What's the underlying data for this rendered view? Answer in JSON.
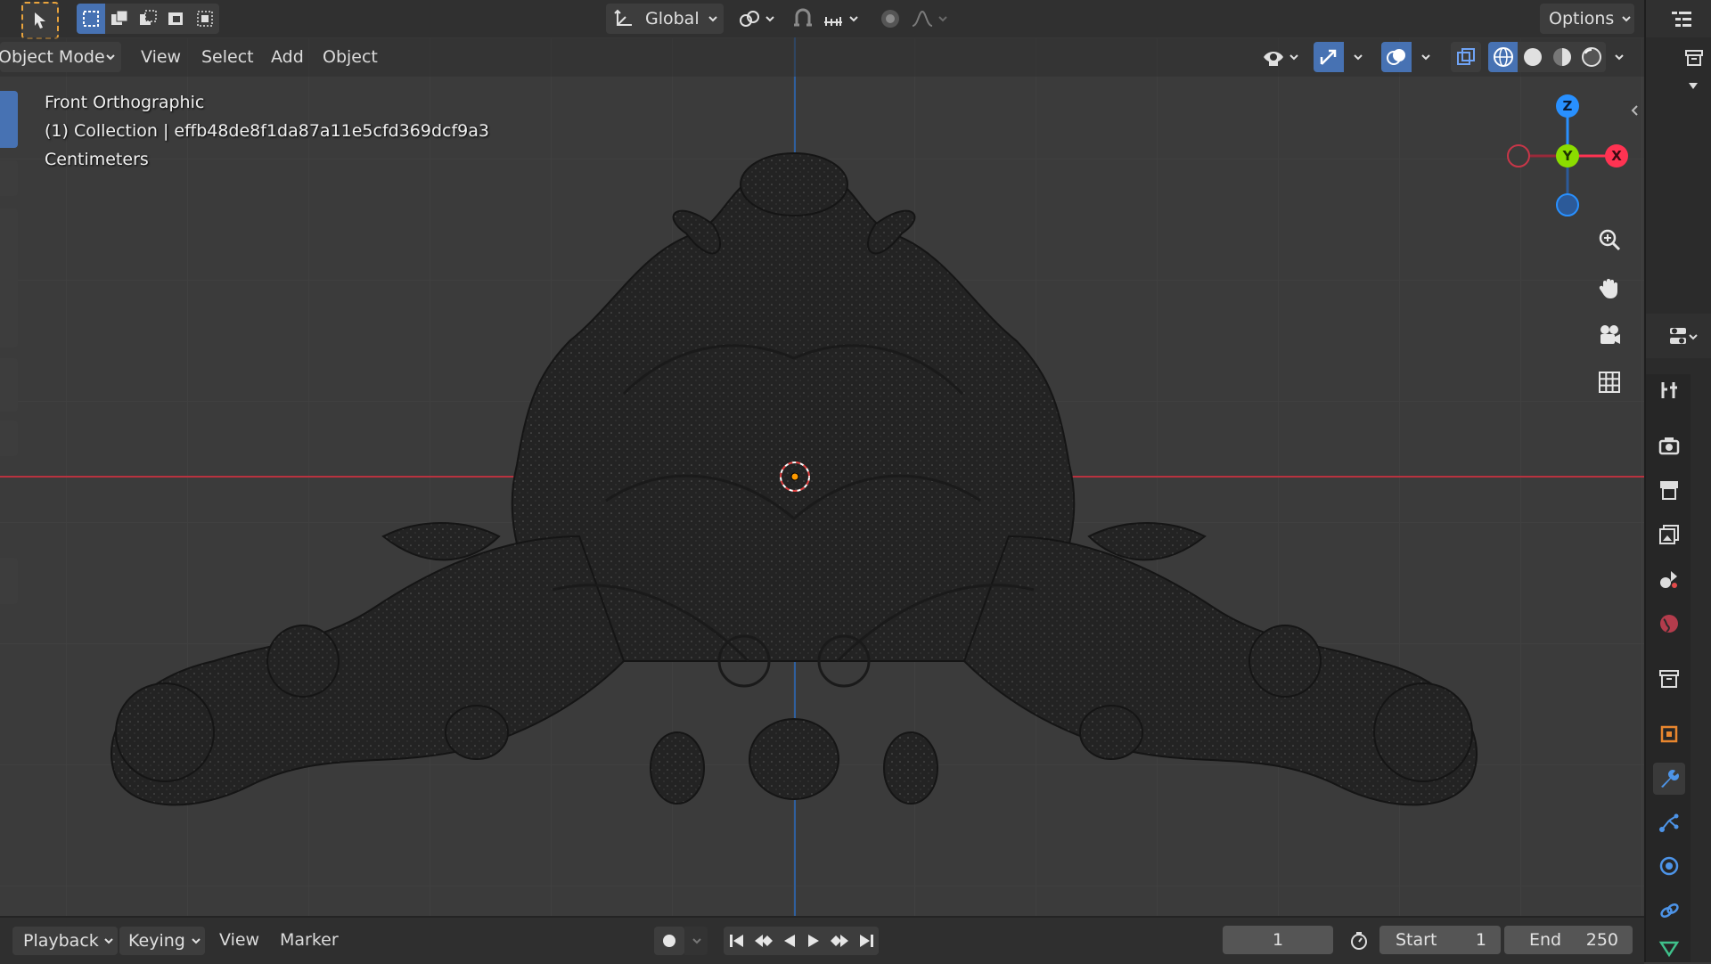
{
  "app": "Blender",
  "tool_header": {
    "transform_orientation": "Global",
    "options_label": "Options"
  },
  "view_header": {
    "mode": "Object Mode",
    "menus": [
      "View",
      "Select",
      "Add",
      "Object"
    ]
  },
  "viewport": {
    "view_name": "Front Orthographic",
    "collection_info": "(1) Collection | effb48de8f1da87a11e5cfd369dcf9a3",
    "units": "Centimeters"
  },
  "gizmo": {
    "z_label": "Z",
    "y_label": "Y",
    "x_label": "X"
  },
  "timeline": {
    "menus": [
      "Playback",
      "Keying",
      "View",
      "Marker"
    ],
    "current_frame": "1",
    "start_label": "Start",
    "start_value": "1",
    "end_label": "End",
    "end_value": "250"
  },
  "colors": {
    "accent_blue": "#4772b3",
    "x_axis": "#ff3352",
    "y_axis": "#8bdc00",
    "z_axis": "#2890ff",
    "header_bg": "#303030",
    "viewport_bg": "#3b3b3b"
  },
  "icons": {
    "tool_header": [
      "select-cursor-icon",
      "select-box-new-icon",
      "select-box-extend-icon",
      "select-box-subtract-icon",
      "select-box-invert-icon",
      "select-box-intersect-icon",
      "transform-orientation-icon",
      "pivot-point-icon",
      "snap-icon",
      "snap-increment-icon",
      "proportional-edit-icon",
      "falloff-curve-icon"
    ],
    "view_header": [
      "visibility-eye-icon",
      "gizmo-icon",
      "overlay-icon",
      "xray-icon",
      "shading-wireframe-icon",
      "shading-solid-icon",
      "shading-material-icon",
      "shading-rendered-icon"
    ],
    "navigation": [
      "zoom-icon",
      "pan-hand-icon",
      "camera-icon",
      "grid-ortho-icon"
    ],
    "properties": [
      "tool-icon",
      "render-icon",
      "output-icon",
      "view-layer-icon",
      "scene-icon",
      "world-icon",
      "collection-icon",
      "object-icon",
      "modifier-wrench-icon",
      "particles-icon",
      "physics-icon",
      "constraints-icon",
      "data-icon"
    ]
  }
}
